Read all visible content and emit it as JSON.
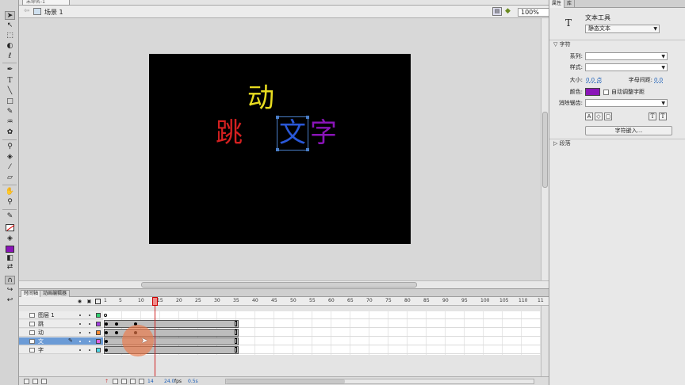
{
  "document": {
    "tab_label": "未命名-1"
  },
  "edit_bar": {
    "back_icon": "back-arrow-icon",
    "scene_label": "场景 1",
    "zoom_value": "100%"
  },
  "tools": [
    "selection",
    "subselection",
    "free-transform",
    "3d-rotation",
    "lasso",
    "pen",
    "text",
    "line",
    "rectangle",
    "pencil",
    "brush",
    "deco",
    "bone",
    "paint-bucket",
    "eyedropper",
    "eraser",
    "hand",
    "zoom",
    "stroke-color",
    "fill-color",
    "black-white",
    "swap-colors",
    "snap",
    "smooth",
    "straighten"
  ],
  "stage": {
    "background": "#000000",
    "glyphs": [
      {
        "text": "动",
        "color": "#e8dc20"
      },
      {
        "text": "跳",
        "color": "#d42020"
      },
      {
        "text": "文",
        "color": "#2a58d8"
      },
      {
        "text": "字",
        "color": "#8a14b8"
      }
    ]
  },
  "timeline": {
    "tabs": [
      "时间轴",
      "动画编辑器"
    ],
    "ruler_ticks": [
      "1",
      "5",
      "10",
      "15",
      "20",
      "25",
      "30",
      "35",
      "40",
      "45",
      "50",
      "55",
      "60",
      "65",
      "70",
      "75",
      "80",
      "85",
      "90",
      "95",
      "100",
      "105",
      "110",
      "11"
    ],
    "current_frame_marker": "15",
    "layers": [
      {
        "name": "图层 1",
        "color": "#30d070"
      },
      {
        "name": "跳",
        "color": "#a040e0"
      },
      {
        "name": "动",
        "color": "#ff8a30"
      },
      {
        "name": "文",
        "color": "#e060e0"
      },
      {
        "name": "字",
        "color": "#50d8e8"
      }
    ],
    "status": {
      "frame": "14",
      "fps": "24.0",
      "fps_unit": "fps",
      "time": "0.5s"
    }
  },
  "properties": {
    "tabs": [
      "属性",
      "库"
    ],
    "tool_icon": "T",
    "tool_name": "文本工具",
    "text_type": "静态文本",
    "section_char": "字符",
    "family_label": "系列:",
    "style_label": "样式:",
    "size_label": "大小:",
    "size_value": "0.0 点",
    "spacing_label": "字母间距:",
    "spacing_value": "0.0",
    "color_label": "颜色:",
    "text_color": "#8a14b8",
    "auto_kern_label": "自动调整字距",
    "antialias_label": "消除锯齿:",
    "embed_button": "字符嵌入...",
    "section_para": "段落"
  }
}
